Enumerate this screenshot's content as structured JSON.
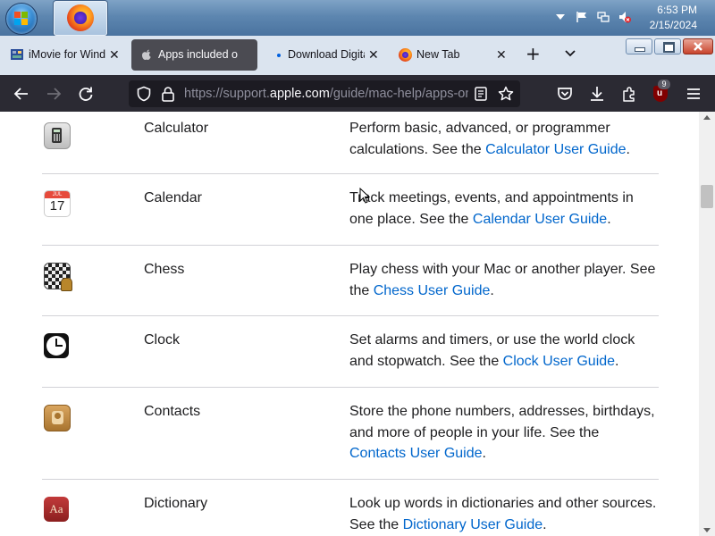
{
  "taskbar": {
    "clock_time": "6:53 PM",
    "clock_date": "2/15/2024"
  },
  "tabs": [
    {
      "label": "iMovie for Wind",
      "favicon": "imovie-icon"
    },
    {
      "label": "Apps included o",
      "favicon": "apple-icon",
      "active": true
    },
    {
      "label": "Download Digita",
      "favicon": "dot-icon"
    },
    {
      "label": "New Tab",
      "favicon": "firefox-icon"
    }
  ],
  "toolbar": {
    "url_host": "https://support.",
    "url_domain": "apple.com",
    "url_path": "/guide/mac-help/apps-on",
    "extension_badge": "9"
  },
  "colors": {
    "link": "#0066cc",
    "toolbar_bg": "#2b2a33",
    "tabstrip_bg": "#dbe4ef"
  },
  "apps": [
    {
      "name": "Calculator",
      "icon": "calculator-icon",
      "desc_before": "Perform basic, advanced, or programmer calculations. See the ",
      "link": "Calculator User Guide",
      "desc_after": "."
    },
    {
      "name": "Calendar",
      "icon": "calendar-icon",
      "icon_month": "JUL",
      "icon_day": "17",
      "desc_before": "Track meetings, events, and appointments in one place. See the ",
      "link": "Calendar User Guide",
      "desc_after": "."
    },
    {
      "name": "Chess",
      "icon": "chess-icon",
      "desc_before": "Play chess with your Mac or another player. See the ",
      "link": "Chess User Guide",
      "desc_after": "."
    },
    {
      "name": "Clock",
      "icon": "clock-icon",
      "desc_before": "Set alarms and timers, or use the world clock and stopwatch. See the ",
      "link": "Clock User Guide",
      "desc_after": "."
    },
    {
      "name": "Contacts",
      "icon": "contacts-icon",
      "desc_before": "Store the phone numbers, addresses, birthdays, and more of people in your life. See the ",
      "link": "Contacts User Guide",
      "desc_after": "."
    },
    {
      "name": "Dictionary",
      "icon": "dictionary-icon",
      "icon_text": "Aa",
      "desc_before": "Look up words in dictionaries and other sources. See the ",
      "link": "Dictionary User Guide",
      "desc_after": "."
    }
  ]
}
